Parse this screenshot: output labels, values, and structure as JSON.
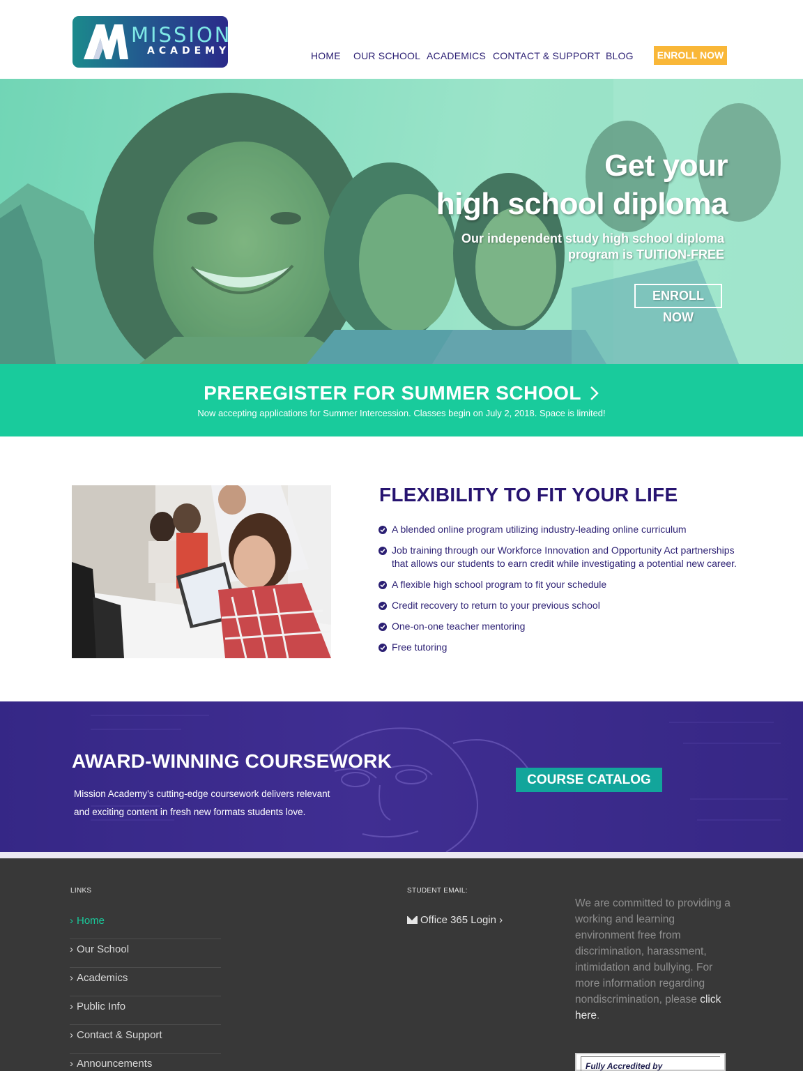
{
  "header": {
    "logo": {
      "line1": "MISSION",
      "line2": "ACADEMY",
      "mark_icon": "mission-m-icon"
    },
    "nav": [
      {
        "label": "HOME"
      },
      {
        "label": "OUR SCHOOL"
      },
      {
        "label": "ACADEMICS"
      },
      {
        "label": "CONTACT & SUPPORT"
      },
      {
        "label": "BLOG"
      }
    ],
    "enroll_label": "ENROLL NOW",
    "colors": {
      "nav_text": "#2b1f73",
      "enroll_bg": "#f9b738"
    }
  },
  "hero": {
    "title_line1": "Get your",
    "title_line2": "high school diploma",
    "subtitle": "Our independent study high school diploma program is TUITION-FREE",
    "button_label": "ENROLL NOW",
    "overlay_color": "#7fdcbc"
  },
  "summer": {
    "title": "PREREGISTER FOR SUMMER SCHOOL",
    "chevron_icon": "chevron-right-icon",
    "text": "Now accepting applications for Summer Intercession. Classes begin on July 2, 2018. Space is limited!",
    "bg_color": "#19cb9c"
  },
  "flexibility": {
    "title": "FLEXIBILITY TO FIT YOUR LIFE",
    "items": [
      {
        "text": "A blended online program utilizing industry-leading online curriculum"
      },
      {
        "text": "Job training through our Workforce Innovation and Opportunity Act partnerships that allows our students to earn credit while investigating a potential new career."
      },
      {
        "text": "A flexible high school program to fit your schedule"
      },
      {
        "text": "Credit recovery to return to your previous school"
      },
      {
        "text": "One-on-one teacher mentoring"
      },
      {
        "text": "Free tutoring"
      }
    ],
    "item_icon": "check-circle-icon"
  },
  "award": {
    "title": "AWARD-WINNING COURSEWORK",
    "text": "Mission Academy’s cutting-edge coursework delivers relevant and exciting content in fresh new formats students love.",
    "button_label": "COURSE CATALOG",
    "bg_color": "#3d2b92",
    "button_color": "#12a59b"
  },
  "footer": {
    "links_heading": "LINKS",
    "links": [
      {
        "label": "Home"
      },
      {
        "label": "Our School"
      },
      {
        "label": "Academics"
      },
      {
        "label": "Public Info"
      },
      {
        "label": "Contact & Support"
      },
      {
        "label": "Announcements"
      }
    ],
    "email_heading": "STUDENT EMAIL:",
    "office_label": "Office 365 Login ›",
    "mail_icon": "envelope-icon",
    "commitment_text": "We are committed to providing a working and learning environment free from discrimination, harassment, intimidation and bullying. For more information regarding nondiscrimination, please",
    "click_here": "click here",
    "commitment_end": ".",
    "accreditation": "Fully Accredited by",
    "bg_color": "#383838",
    "active_color": "#19cb9c"
  }
}
